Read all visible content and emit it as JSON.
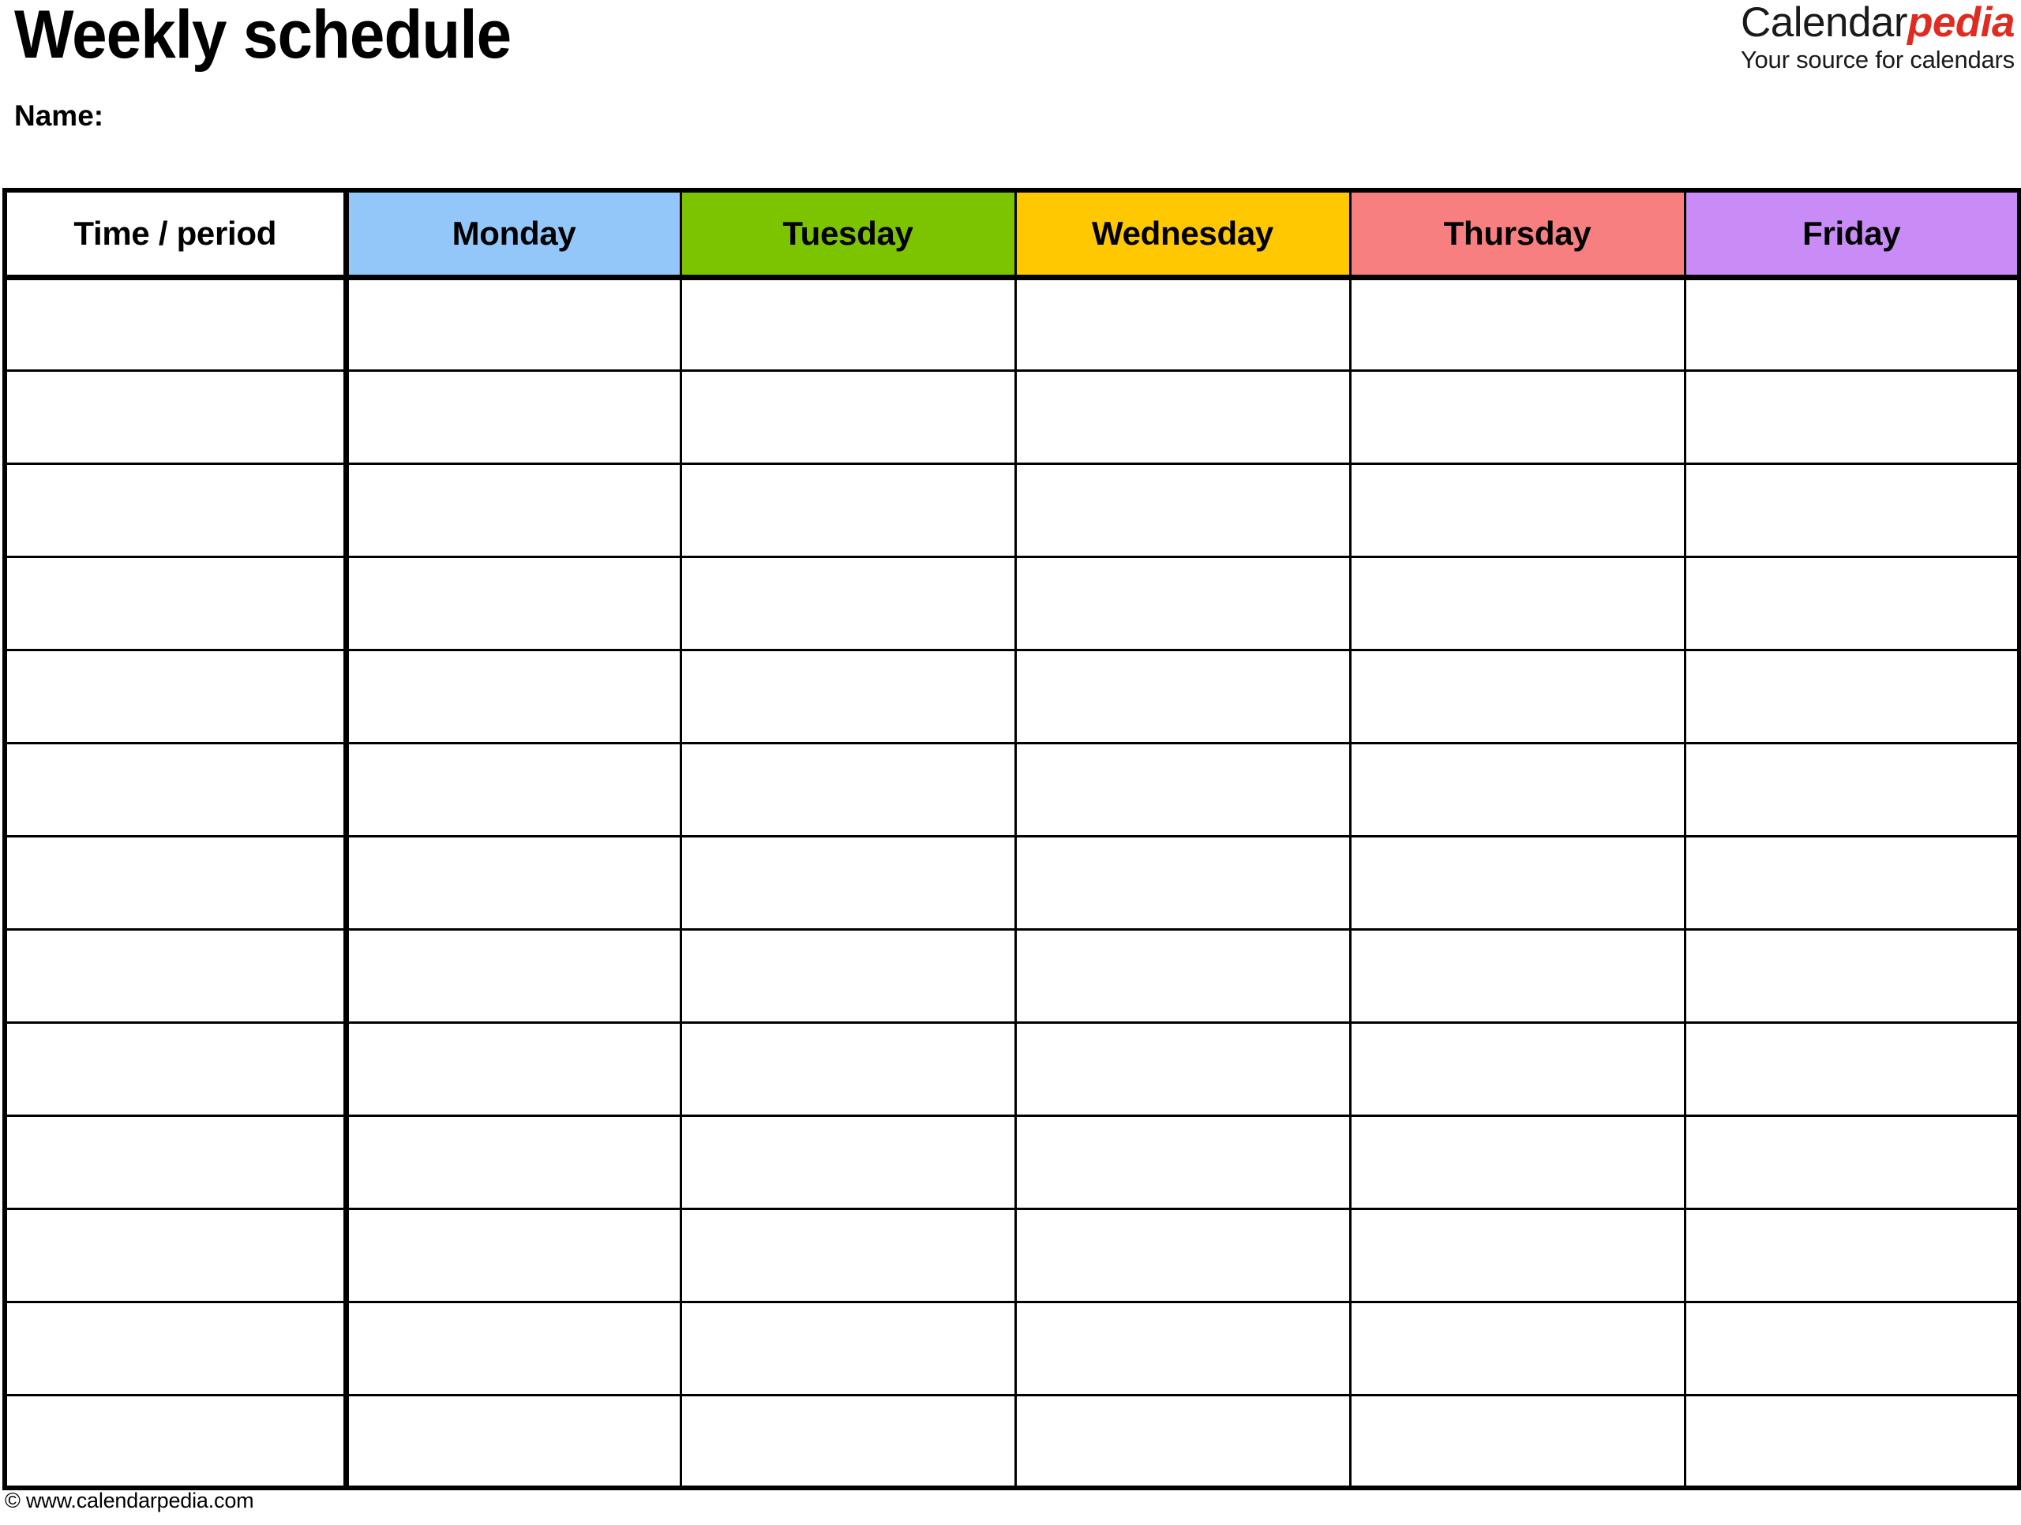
{
  "document": {
    "title": "Weekly schedule",
    "name_label": "Name:"
  },
  "brand": {
    "name_primary": "Calendar",
    "name_accent": "pedia",
    "tagline": "Your source for calendars",
    "accent_color": "#e02b20",
    "primary_color": "#1a1a1a"
  },
  "table": {
    "columns": [
      {
        "label": "Time / period",
        "background": "#ffffff",
        "kind": "time"
      },
      {
        "label": "Monday",
        "background": "#93c7f9",
        "kind": "day"
      },
      {
        "label": "Tuesday",
        "background": "#7dc400",
        "kind": "day"
      },
      {
        "label": "Wednesday",
        "background": "#ffc800",
        "kind": "day"
      },
      {
        "label": "Thursday",
        "background": "#f87f7f",
        "kind": "day"
      },
      {
        "label": "Friday",
        "background": "#c98bf5",
        "kind": "day"
      }
    ],
    "row_count": 13,
    "rows": [
      [
        "",
        "",
        "",
        "",
        "",
        ""
      ],
      [
        "",
        "",
        "",
        "",
        "",
        ""
      ],
      [
        "",
        "",
        "",
        "",
        "",
        ""
      ],
      [
        "",
        "",
        "",
        "",
        "",
        ""
      ],
      [
        "",
        "",
        "",
        "",
        "",
        ""
      ],
      [
        "",
        "",
        "",
        "",
        "",
        ""
      ],
      [
        "",
        "",
        "",
        "",
        "",
        ""
      ],
      [
        "",
        "",
        "",
        "",
        "",
        ""
      ],
      [
        "",
        "",
        "",
        "",
        "",
        ""
      ],
      [
        "",
        "",
        "",
        "",
        "",
        ""
      ],
      [
        "",
        "",
        "",
        "",
        "",
        ""
      ],
      [
        "",
        "",
        "",
        "",
        "",
        ""
      ],
      [
        "",
        "",
        "",
        "",
        "",
        ""
      ]
    ]
  },
  "footer": {
    "copyright": "© www.calendarpedia.com"
  }
}
